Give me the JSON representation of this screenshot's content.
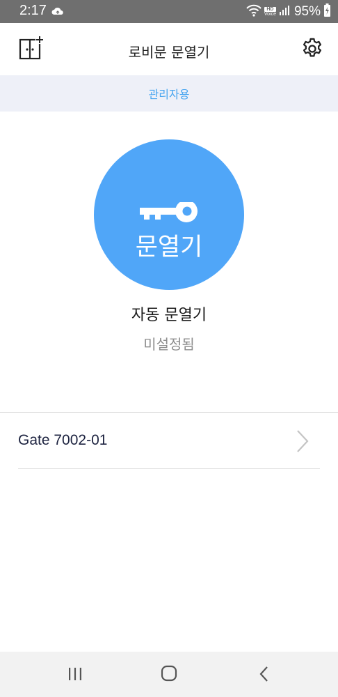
{
  "status_bar": {
    "time": "2:17",
    "battery_percent": "95%",
    "hd_label": "HD",
    "voice_label": "Voice"
  },
  "app_bar": {
    "title": "로비문 문열기"
  },
  "admin_banner": {
    "label": "관리자용"
  },
  "open_button": {
    "label": "문열기",
    "color": "#50a6f8"
  },
  "auto_open": {
    "title": "자동 문열기",
    "status": "미설정됨"
  },
  "gates": [
    {
      "name": "Gate 7002-01"
    }
  ],
  "colors": {
    "accent": "#4aa6f0",
    "banner_bg": "#eef0f8",
    "status_bar_bg": "#6f6f6f"
  },
  "icons": {
    "app_bar_left": "door-add-icon",
    "app_bar_right": "gear-icon",
    "button": "key-icon",
    "list_item": "chevron-right-icon",
    "nav": [
      "recent-apps-icon",
      "home-icon",
      "back-icon"
    ]
  }
}
